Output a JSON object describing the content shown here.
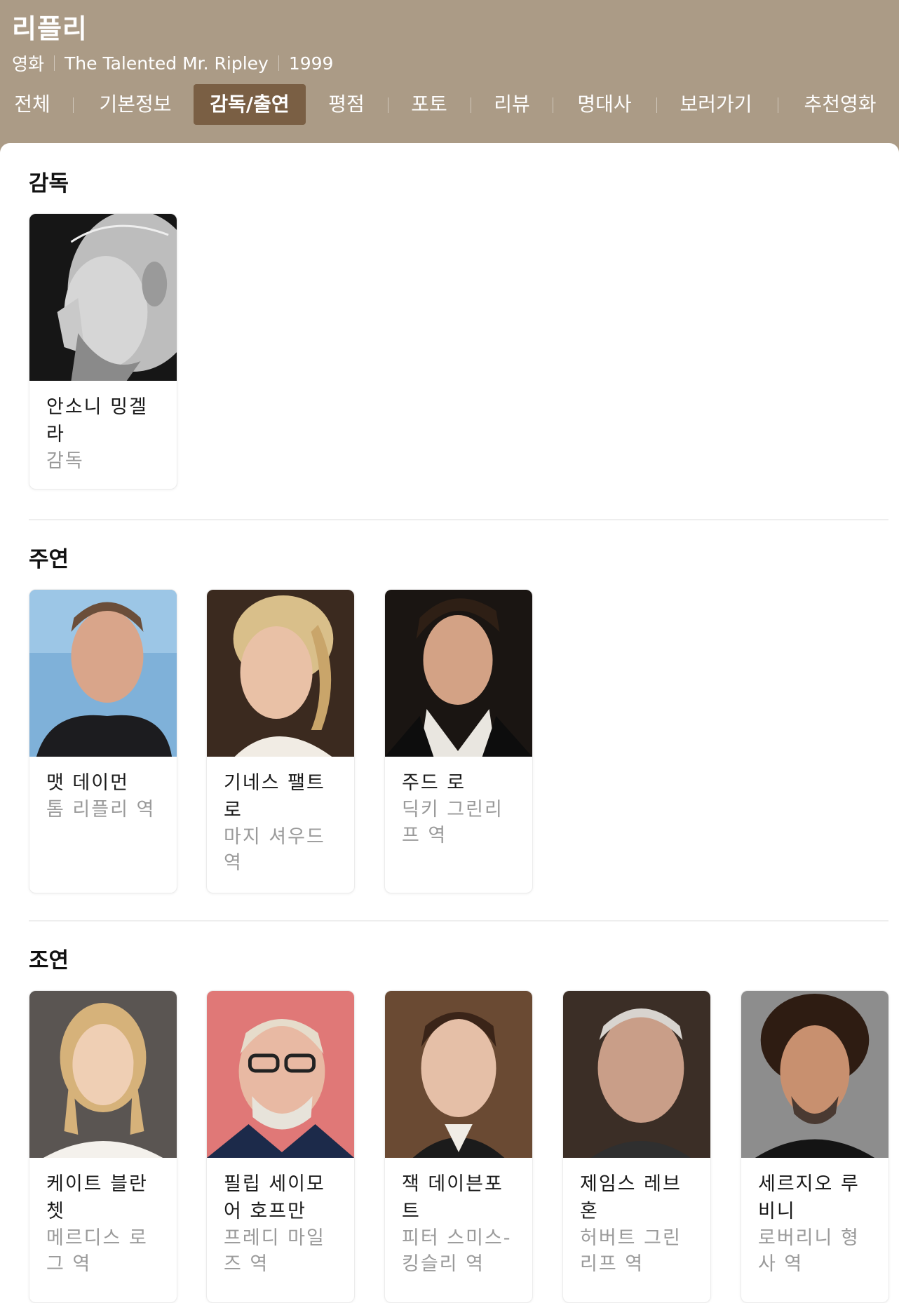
{
  "header": {
    "title": "리플리",
    "meta": [
      "영화",
      "The Talented Mr. Ripley",
      "1999"
    ]
  },
  "tabs": [
    {
      "label": "전체",
      "active": false
    },
    {
      "label": "기본정보",
      "active": false
    },
    {
      "label": "감독/출연",
      "active": true
    },
    {
      "label": "평점",
      "active": false
    },
    {
      "label": "포토",
      "active": false
    },
    {
      "label": "리뷰",
      "active": false
    },
    {
      "label": "명대사",
      "active": false
    },
    {
      "label": "보러가기",
      "active": false
    },
    {
      "label": "추천영화",
      "active": false
    }
  ],
  "sections": {
    "director": {
      "title": "감독",
      "people": [
        {
          "name": "안소니 밍겔라",
          "role": "감독",
          "photo": "director-portrait-bw"
        }
      ]
    },
    "lead": {
      "title": "주연",
      "people": [
        {
          "name": "맷 데이먼",
          "role": "톰 리플리 역",
          "photo": "actor-portrait"
        },
        {
          "name": "기네스 팰트로",
          "role": "마지 셔우드 역",
          "photo": "actress-portrait"
        },
        {
          "name": "주드 로",
          "role": "딕키 그린리프 역",
          "photo": "actor-portrait"
        }
      ]
    },
    "supporting": {
      "title": "조연",
      "people": [
        {
          "name": "케이트 블란쳇",
          "role": "메르디스 로그 역",
          "photo": "actress-portrait"
        },
        {
          "name": "필립 세이모어 호프만",
          "role": "프레디 마일즈 역",
          "photo": "actor-portrait"
        },
        {
          "name": "잭 데이븐포트",
          "role": "피터 스미스-킹슬리 역",
          "photo": "actor-portrait"
        },
        {
          "name": "제임스 레브혼",
          "role": "허버트 그린리프 역",
          "photo": "actor-portrait"
        },
        {
          "name": "세르지오 루비니",
          "role": "로버리니 형사 역",
          "photo": "actor-portrait"
        }
      ]
    }
  },
  "colors": {
    "header_bg": "#ab9b86",
    "active_tab_bg": "#7a5f44",
    "role_text": "#9a9a9a"
  }
}
